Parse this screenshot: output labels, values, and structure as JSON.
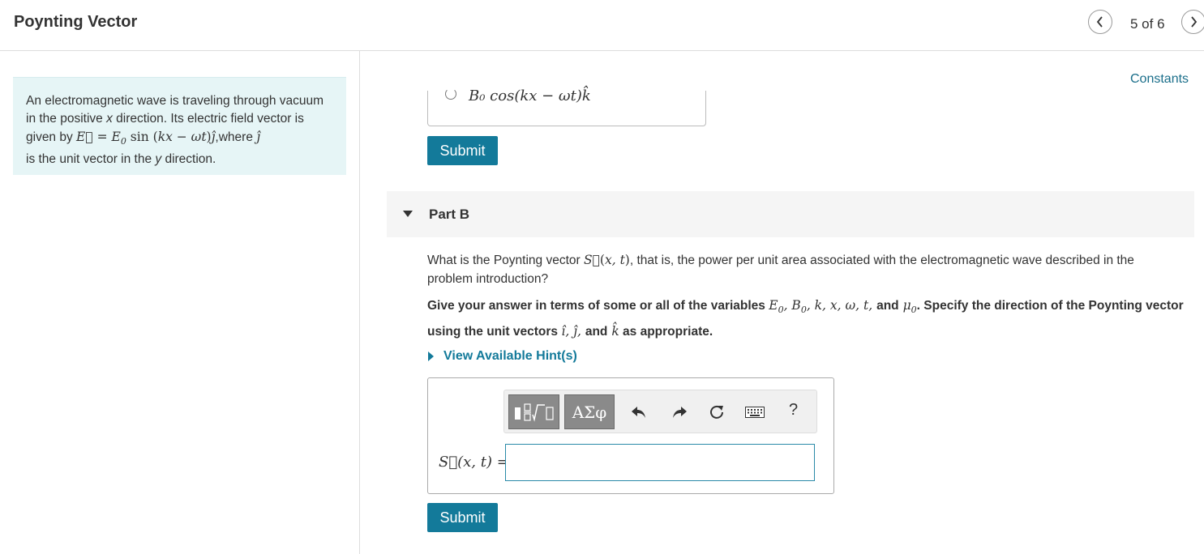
{
  "header": {
    "title": "Poynting Vector",
    "pager": "5 of 6",
    "prev_icon": "chevron-left-icon",
    "next_icon": "chevron-right-icon"
  },
  "intro": {
    "text_1": "An electromagnetic wave is traveling through vacuum in the positive ",
    "x_var": "x",
    "text_2": " direction. Its electric field vector is given by ",
    "text_3": ",where ",
    "text_4": " is the unit vector in the ",
    "y_var": "y",
    "text_5": " direction."
  },
  "constants_link": "Constants",
  "part_a": {
    "option_expr": "B₀ cos(kx − ωt)k̂",
    "submit_label": "Submit"
  },
  "part_b": {
    "label": "Part B",
    "question_1": "What is the Poynting vector ",
    "question_2": ", that is, the power per unit area associated with the electromagnetic wave described in the problem introduction?",
    "instruction_1": "Give your answer in terms of some or all of the variables ",
    "instruction_2": ". Specify the direction of the Poynting vector using the unit vectors ",
    "instruction_3": " as appropriate.",
    "hint_label": "View Available Hint(s)",
    "answer_label": "S⃗(x, t) =",
    "input_value": "",
    "submit_label": "Submit"
  },
  "toolbar": {
    "templates_icon": "math-templates-icon",
    "greek_label": "ΑΣφ",
    "undo_icon": "undo-icon",
    "redo_icon": "redo-icon",
    "reset_icon": "reset-icon",
    "keyboard_icon": "keyboard-icon",
    "help_label": "?"
  },
  "colors": {
    "accent": "#137a9a",
    "intro_bg": "#e6f5f6",
    "toolbar_button": "#8a8a8a"
  }
}
